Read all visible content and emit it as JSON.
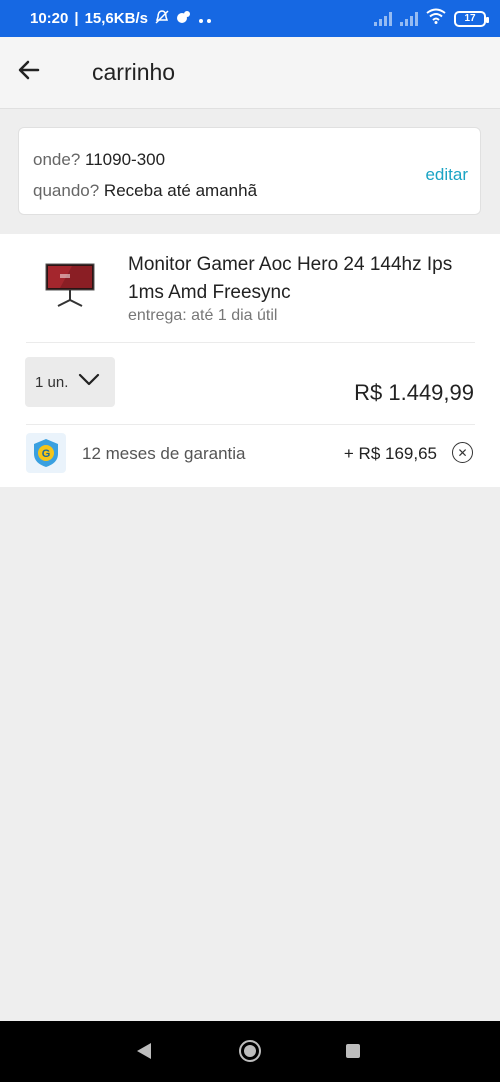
{
  "status_bar": {
    "time": "10:20",
    "speed": "15,6KB/s",
    "battery": "17",
    "icons": [
      "mute-icon",
      "app-icon",
      "more-icon",
      "signal-icon",
      "signal-icon",
      "wifi-icon",
      "battery-icon"
    ]
  },
  "header": {
    "title": "carrinho",
    "back_icon": "arrow-left-icon"
  },
  "delivery": {
    "where_label": "onde?",
    "where_value": "11090-300",
    "when_label": "quando?",
    "when_value": "Receba até amanhã",
    "edit_label": "editar"
  },
  "cart_item": {
    "name": "Monitor Gamer Aoc Hero 24 144hz Ips 1ms Amd Freesync",
    "delivery": "entrega: até 1 dia útil",
    "quantity": "1 un.",
    "price": "R$ 1.449,99",
    "warranty": {
      "label": "12 meses de garantia",
      "price": "+ R$ 169,65"
    }
  },
  "colors": {
    "status_bar": "#1668e3",
    "accent": "#1ba4c4",
    "background": "#eeeeee"
  }
}
